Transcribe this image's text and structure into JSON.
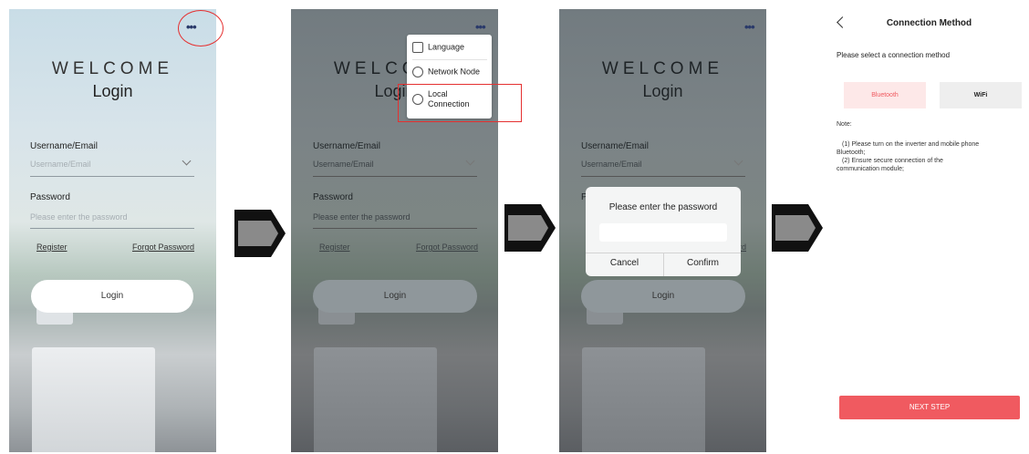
{
  "login": {
    "menu_dots": "•••",
    "welcome": "WELCOME",
    "title": "Login",
    "username_label": "Username/Email",
    "username_placeholder": "Username/Email",
    "password_label": "Password",
    "password_placeholder": "Please enter the password",
    "register": "Register",
    "forgot_password": "Forgot Password",
    "login_button": "Login"
  },
  "menu": {
    "items": [
      {
        "label": "Language",
        "icon": "language-icon"
      },
      {
        "label": "Network Node",
        "icon": "globe-icon"
      },
      {
        "label": "Local Connection",
        "label_line1": "Local",
        "label_line2": "Connection",
        "icon": "local-connection-icon"
      }
    ]
  },
  "password_dialog": {
    "title": "Please enter the password",
    "cancel": "Cancel",
    "confirm": "Confirm"
  },
  "connection_method": {
    "title": "Connection Method",
    "subtitle": "Please select a connection method",
    "tabs": [
      {
        "label": "Bluetooth",
        "selected": true
      },
      {
        "label": "WiFi",
        "selected": false
      }
    ],
    "note_title": "Note:",
    "note_lines": [
      "(1) Please turn on the inverter and mobile phone",
      "Bluetooth;",
      "(2) Ensure secure connection of the",
      "communication module;"
    ],
    "next_button": "NEXT STEP"
  },
  "colors": {
    "accent_red": "#f05a60",
    "selected_tab_bg": "#fde8e8",
    "selected_tab_text": "#f05a60",
    "unselected_tab_bg": "#eeeeee",
    "highlight_outline": "#e53030"
  }
}
